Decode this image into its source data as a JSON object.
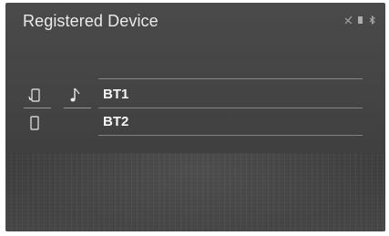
{
  "screen": {
    "title": "Registered Device",
    "status_icons": [
      "signal-off-icon",
      "battery-icon",
      "bluetooth-icon"
    ]
  },
  "devices": [
    {
      "name": "BT1",
      "device_icon": "phone-connected-icon",
      "profile_icon": "music-note-icon"
    },
    {
      "name": "BT2",
      "device_icon": "phone-icon",
      "profile_icon": ""
    }
  ]
}
